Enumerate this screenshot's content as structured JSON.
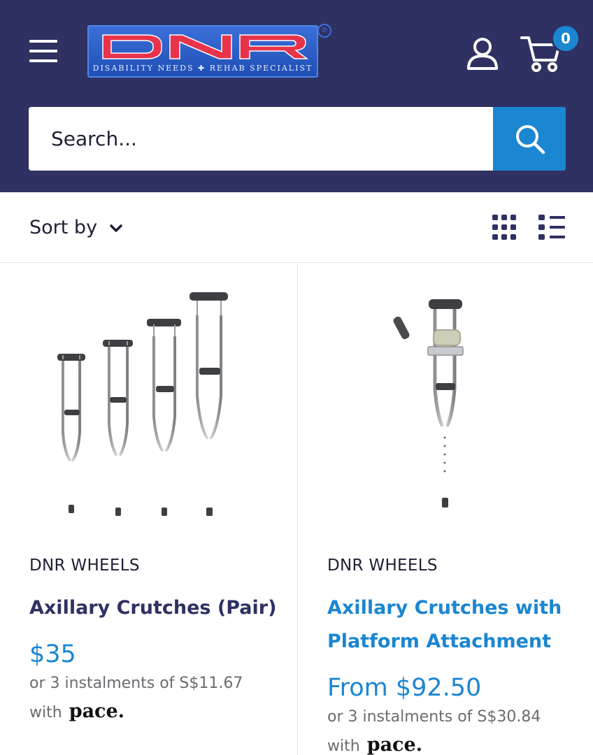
{
  "header": {
    "logo": {
      "wordmark": "DNR",
      "tagline": "DISABILITY NEEDS ✚ REHAB SPECIALIST",
      "registered": "®"
    },
    "menu_icon": "hamburger-menu-icon",
    "account_icon": "user-icon",
    "cart_icon": "cart-icon",
    "cart_count": "0",
    "colors": {
      "header_bg": "#2e3162",
      "accent": "#1b86d2"
    }
  },
  "search": {
    "placeholder": "Search...",
    "value": "",
    "button_icon": "search-icon"
  },
  "toolbar": {
    "sort_label": "Sort by",
    "sort_icon": "chevron-down-icon",
    "view_grid_icon": "grid-view-icon",
    "view_list_icon": "list-view-icon"
  },
  "products": [
    {
      "vendor": "DNR WHEELS",
      "title": "Axillary Crutches (Pair)",
      "price": "$35",
      "instalment_text": "or 3 instalments of S$11.67",
      "instalment_with": "with",
      "instalment_brand": "pace."
    },
    {
      "vendor": "DNR WHEELS",
      "title": "Axillary Crutches with Platform Attachment",
      "price": "From $92.50",
      "instalment_text": "or 3 instalments of S$30.84",
      "instalment_with": "with",
      "instalment_brand": "pace."
    }
  ]
}
